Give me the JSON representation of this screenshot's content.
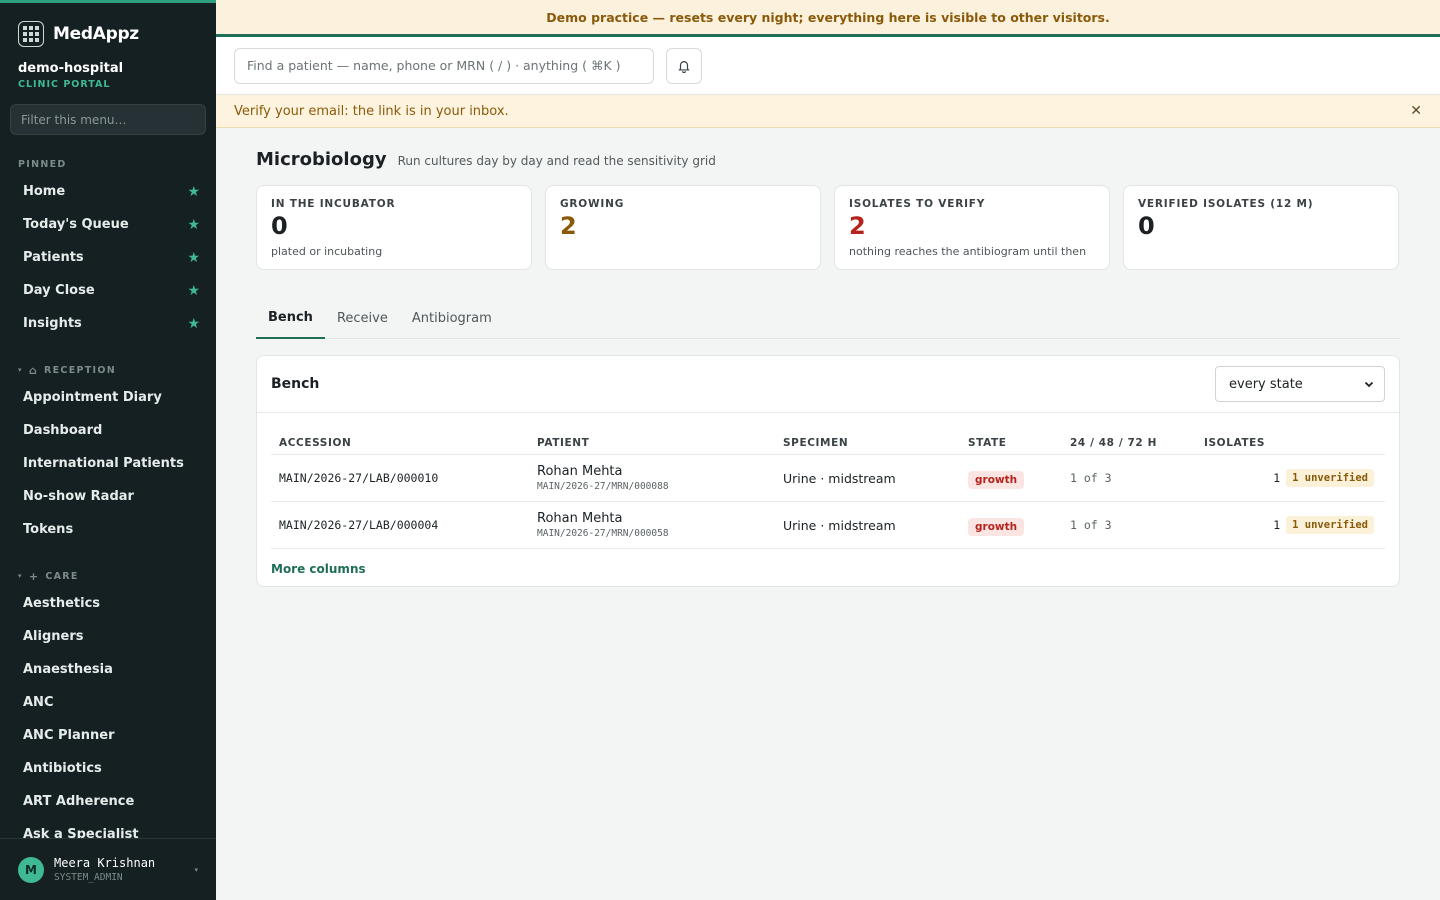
{
  "brand": {
    "name": "MedAppz"
  },
  "org": {
    "name": "demo-hospital",
    "subtitle": "CLINIC PORTAL"
  },
  "sidebar": {
    "filter_placeholder": "Filter this menu…",
    "pinned_label": "PINNED",
    "pinned": [
      {
        "label": "Home"
      },
      {
        "label": "Today's Queue"
      },
      {
        "label": "Patients"
      },
      {
        "label": "Day Close"
      },
      {
        "label": "Insights"
      }
    ],
    "reception_label": "RECEPTION",
    "reception": [
      {
        "label": "Appointment Diary"
      },
      {
        "label": "Dashboard"
      },
      {
        "label": "International Patients"
      },
      {
        "label": "No-show Radar"
      },
      {
        "label": "Tokens"
      }
    ],
    "care_label": "CARE",
    "care": [
      {
        "label": "Aesthetics"
      },
      {
        "label": "Aligners"
      },
      {
        "label": "Anaesthesia"
      },
      {
        "label": "ANC"
      },
      {
        "label": "ANC Planner"
      },
      {
        "label": "Antibiotics"
      },
      {
        "label": "ART Adherence"
      },
      {
        "label": "Ask a Specialist"
      }
    ]
  },
  "user": {
    "initial": "M",
    "name": "Meera Krishnan",
    "role": "SYSTEM_ADMIN"
  },
  "demo_banner": "Demo practice — resets every night; everything here is visible to other visitors.",
  "search": {
    "placeholder": "Find a patient — name, phone or MRN ( / ) · anything ( ⌘K )"
  },
  "verify_banner": "Verify your email: the link is in your inbox.",
  "page": {
    "title": "Microbiology",
    "subtitle": "Run cultures day by day and read the sensitivity grid"
  },
  "stats": [
    {
      "label": "IN THE INCUBATOR",
      "value": "0",
      "hint": "plated or incubating",
      "color": "#1b2124"
    },
    {
      "label": "GROWING",
      "value": "2",
      "hint": "",
      "color": "#8a5a0a"
    },
    {
      "label": "ISOLATES TO VERIFY",
      "value": "2",
      "hint": "nothing reaches the antibiogram until then",
      "color": "#b4231c"
    },
    {
      "label": "VERIFIED ISOLATES (12 M)",
      "value": "0",
      "hint": "",
      "color": "#1b2124"
    }
  ],
  "tabs": [
    {
      "label": "Bench"
    },
    {
      "label": "Receive"
    },
    {
      "label": "Antibiogram"
    }
  ],
  "bench": {
    "title": "Bench",
    "filter_value": "every state",
    "columns": [
      "ACCESSION",
      "PATIENT",
      "SPECIMEN",
      "STATE",
      "24 / 48 / 72 H",
      "ISOLATES"
    ],
    "rows": [
      {
        "accession": "MAIN/2026-27/LAB/000010",
        "patient": "Rohan Mehta",
        "mrn": "MAIN/2026-27/MRN/000088",
        "specimen": "Urine · midstream",
        "state": "growth",
        "progress": "1 of 3",
        "isolates": "1",
        "unverified": "1 unverified"
      },
      {
        "accession": "MAIN/2026-27/LAB/000004",
        "patient": "Rohan Mehta",
        "mrn": "MAIN/2026-27/MRN/000058",
        "specimen": "Urine · midstream",
        "state": "growth",
        "progress": "1 of 3",
        "isolates": "1",
        "unverified": "1 unverified"
      }
    ],
    "more_columns": "More columns"
  }
}
